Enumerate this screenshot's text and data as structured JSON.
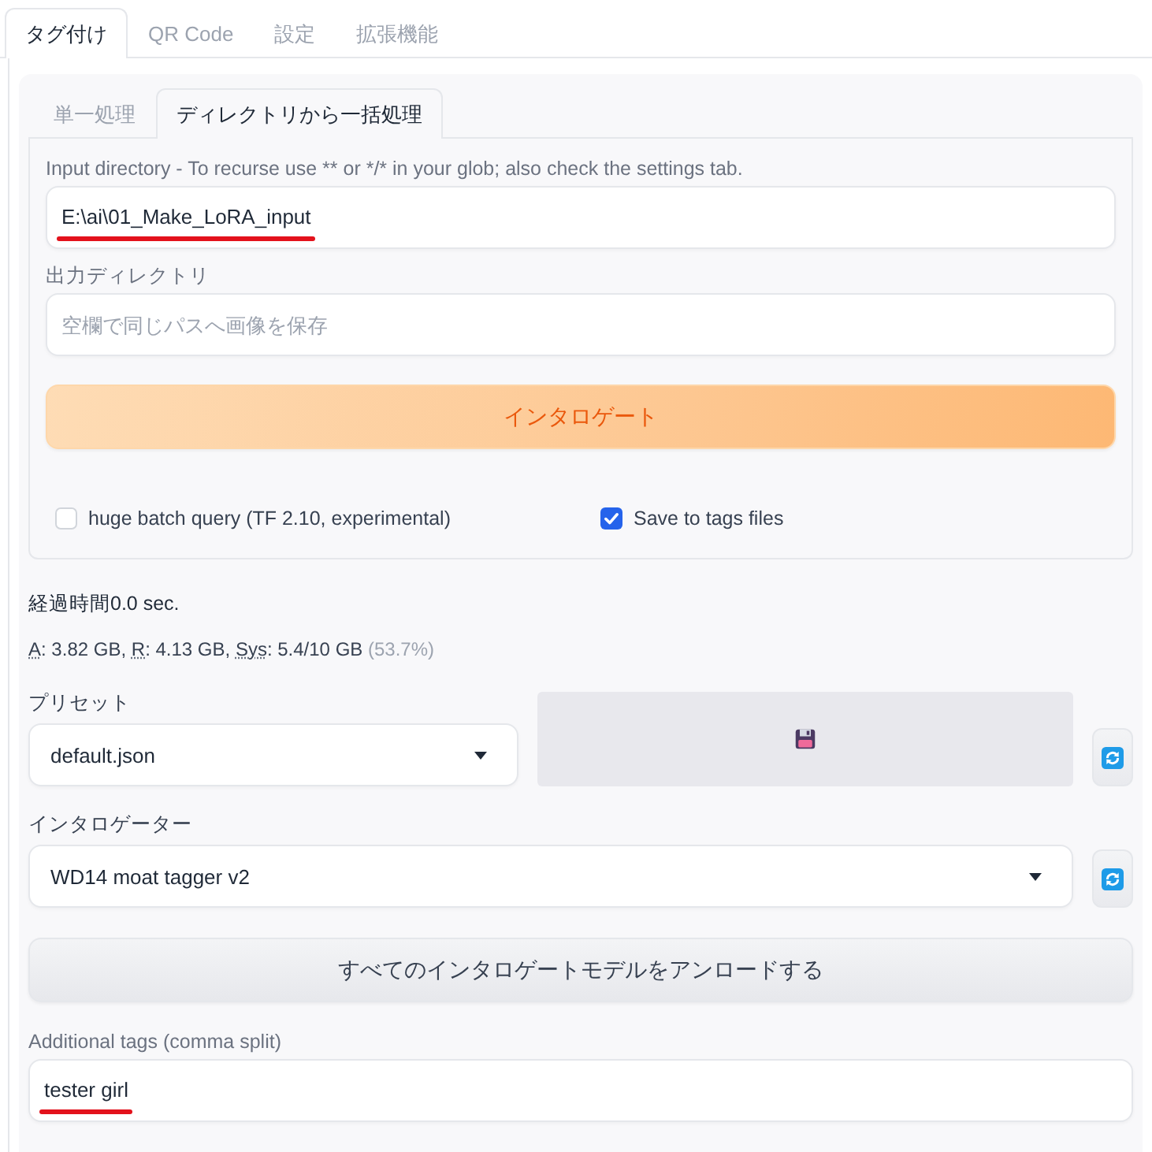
{
  "tabs": [
    {
      "label": "タグ付け",
      "selected": true
    },
    {
      "label": "QR Code",
      "selected": false
    },
    {
      "label": "設定",
      "selected": false
    },
    {
      "label": "拡張機能",
      "selected": false
    }
  ],
  "subtabs": [
    {
      "label": "単一処理",
      "selected": false
    },
    {
      "label": "ディレクトリから一括処理",
      "selected": true
    }
  ],
  "batch_panel": {
    "input_directory": {
      "label": "Input directory - To recurse use ** or */* in your glob; also check the settings tab.",
      "value": "E:\\ai\\01_Make_LoRA_input",
      "underlined": true
    },
    "output_directory": {
      "label": "出力ディレクトリ",
      "placeholder": "空欄で同じパスへ画像を保存"
    },
    "interrogate_button": "インタロゲート",
    "options": [
      {
        "label": "huge batch query (TF 2.10, experimental)",
        "checked": false
      },
      {
        "label": "Save to tags files",
        "checked": true
      }
    ]
  },
  "elapsed": "経過時間0.0 sec.",
  "memory": [
    {
      "text": "A",
      "kind": "abbr"
    },
    {
      "text": ": 3.82 GB, ",
      "kind": "plain"
    },
    {
      "text": "R",
      "kind": "abbr"
    },
    {
      "text": ": 4.13 GB, ",
      "kind": "plain"
    },
    {
      "text": "Sys",
      "kind": "abbr"
    },
    {
      "text": ": 5.4/10 GB ",
      "kind": "plain"
    },
    {
      "text": "(53.7%)",
      "kind": "muted"
    }
  ],
  "preset": {
    "label": "プリセット",
    "value": "default.json"
  },
  "interrogator": {
    "label": "インタロゲーター",
    "value": "WD14 moat tagger v2"
  },
  "unload_button": "すべてのインタロゲートモデルをアンロードする",
  "additional_tags": {
    "label": "Additional tags (comma split)",
    "value": "tester girl",
    "underlined": true
  }
}
